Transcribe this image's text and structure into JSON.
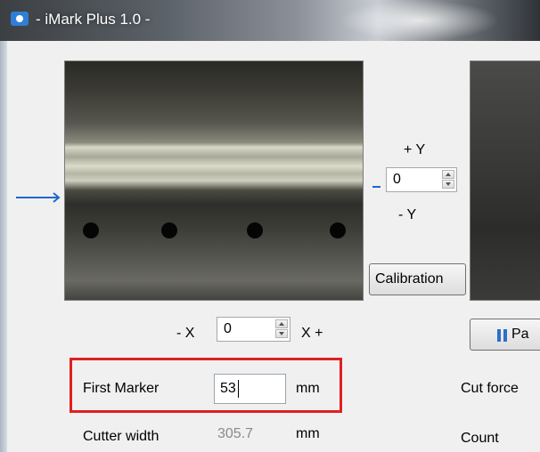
{
  "window": {
    "title": "- iMark Plus 1.0 -"
  },
  "colors": {
    "highlight": "#e02020",
    "accent": "#1e68c8"
  },
  "y_control": {
    "plus_label": "+ Y",
    "minus_label": "- Y",
    "value": "0"
  },
  "x_control": {
    "minus_label": "- X",
    "plus_label": "X +",
    "value": "0"
  },
  "calibration_button": {
    "label": "Calibration"
  },
  "pause_button": {
    "label": "Pa"
  },
  "first_marker": {
    "label": "First Marker",
    "value": "53",
    "unit": "mm"
  },
  "cutter_width": {
    "label": "Cutter width",
    "value": "305.7",
    "unit": "mm"
  },
  "right_panel": {
    "cut_force_label": "Cut force",
    "count_label": "Count"
  },
  "icons": {
    "app": "eye-icon",
    "arrow": "arrow-right-icon",
    "pause": "pause-icon"
  }
}
